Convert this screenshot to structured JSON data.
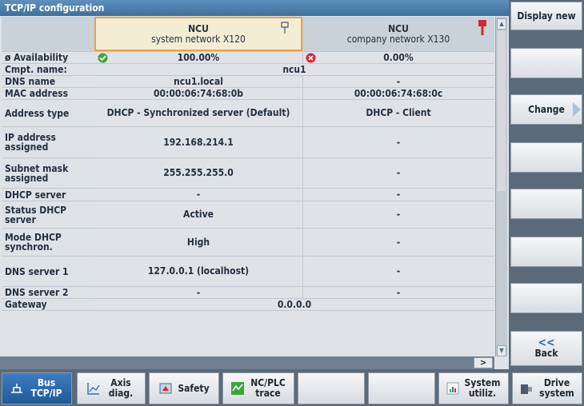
{
  "window": {
    "title": "TCP/IP configuration"
  },
  "header": {
    "col1": {
      "line1": "NCU",
      "line2": "system network X120"
    },
    "col2": {
      "line1": "NCU",
      "line2": "company network X130"
    }
  },
  "rows": [
    {
      "label": "ø Availability",
      "c1": "100.00%",
      "c2": "0.00%"
    },
    {
      "label": "Cmpt. name:",
      "span": "ncu1"
    },
    {
      "label": "DNS name",
      "c1": "ncu1.local",
      "c2": "-"
    },
    {
      "label": "MAC address",
      "c1": "00:00:06:74:68:0b",
      "c2": "00:00:06:74:68:0c"
    },
    {
      "label": "Address type",
      "c1": "DHCP - Synchronized server (Default)",
      "c2": "DHCP - Client"
    },
    {
      "label": "IP address assigned",
      "c1": "192.168.214.1",
      "c2": "-"
    },
    {
      "label": "Subnet mask assigned",
      "c1": "255.255.255.0",
      "c2": "-"
    },
    {
      "label": "DHCP server",
      "c1": "-",
      "c2": "-"
    },
    {
      "label": "Status DHCP server",
      "c1": "Active",
      "c2": "-"
    },
    {
      "label": "Mode DHCP synchron.",
      "c1": "High",
      "c2": "-"
    },
    {
      "label": "DNS server 1",
      "c1": "127.0.0.1 (localhost)",
      "c2": "-"
    },
    {
      "label": "DNS server 2",
      "c1": "-",
      "c2": "-"
    },
    {
      "label": "Gateway",
      "span": "0.0.0.0"
    }
  ],
  "scroll": {
    "right_arrow": ">"
  },
  "softkeys_right": {
    "display_new": "Display new",
    "change": "Change",
    "back_arrow": "<<",
    "back": "Back"
  },
  "softkeys_bottom": {
    "bus": "Bus TCP/IP",
    "axis": "Axis diag.",
    "safety": "Safety",
    "ncplc": "NC/PLC trace",
    "sysutil": "System utiliz.",
    "drive": "Drive system"
  },
  "colors": {
    "ok": "#3aa53a",
    "error": "#d7262b",
    "active_softkey": "#2a67a8"
  }
}
